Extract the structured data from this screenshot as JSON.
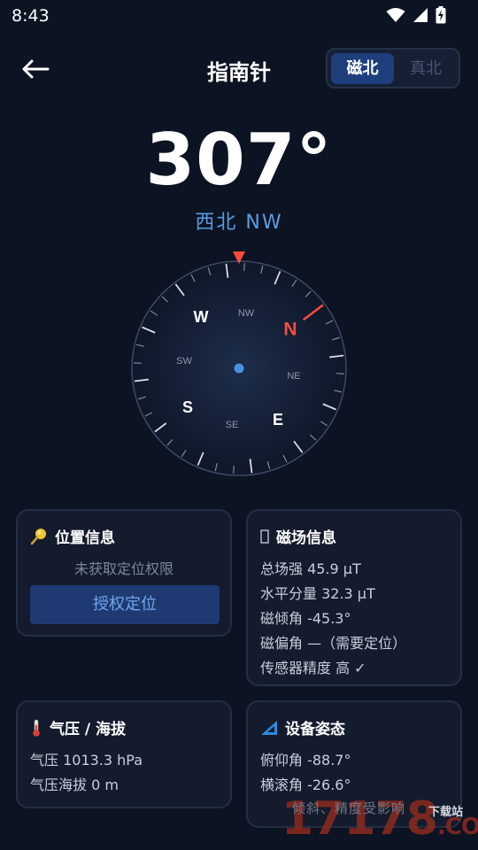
{
  "status_bar": {
    "time": "8:43"
  },
  "header": {
    "title": "指南针",
    "mode_options": [
      "磁北",
      "真北"
    ],
    "active_mode": "磁北"
  },
  "heading": {
    "degrees": "307°",
    "direction_text": "西北  NW"
  },
  "compass": {
    "labels": {
      "N": "N",
      "S": "S",
      "E": "E",
      "W": "W",
      "NW": "NW",
      "NE": "NE",
      "SE": "SE",
      "SW": "SW"
    },
    "heading_deg": 307,
    "accent_color": "#ff4a3d",
    "center_dot_color": "#4a90e2"
  },
  "location_card": {
    "title": "位置信息",
    "status": "未获取定位权限",
    "button": "授权定位"
  },
  "magnetic_card": {
    "title": "磁场信息",
    "lines": [
      "总场强  45.9 μT",
      "水平分量  32.3 μT",
      "磁倾角  -45.3°",
      "磁偏角  —（需要定位）",
      "传感器精度  高 ✓"
    ]
  },
  "pressure_card": {
    "title": "气压 / 海拔",
    "lines": [
      "气压  1013.3 hPa",
      "气压海拔  0 m"
    ]
  },
  "attitude_card": {
    "title": "设备姿态",
    "lines": [
      "俯仰角  -88.7°",
      "横滚角  -26.6°"
    ]
  },
  "watermark": {
    "line": "倾斜、精度受影响",
    "brand": "17178",
    "brand_suffix": ".COM",
    "site": "下载站"
  }
}
